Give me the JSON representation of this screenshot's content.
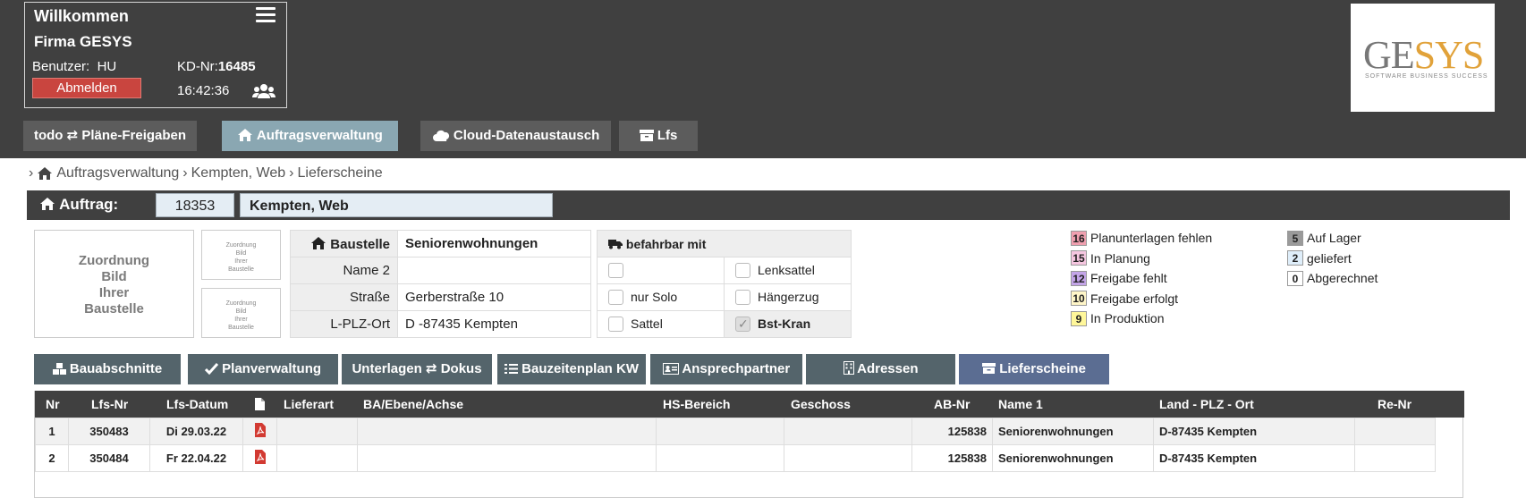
{
  "header": {
    "welcome": "Willkommen",
    "firm": "Firma GESYS",
    "user_label": "Benutzer:",
    "user_value": "HU",
    "kd_label": "KD-Nr:",
    "kd_value": "16485",
    "logout": "Abmelden",
    "time": "16:42:36"
  },
  "logo": {
    "ge": "GE",
    "sys": "SYS",
    "tagline": "SOFTWARE BUSINESS SUCCESS"
  },
  "tabs": [
    {
      "label": "todo ⇄ Pläne-Freigaben"
    },
    {
      "label": "Auftragsverwaltung"
    },
    {
      "label": "Cloud-Datenaustausch"
    },
    {
      "label": "Lfs"
    }
  ],
  "breadcrumb": [
    "Auftragsverwaltung",
    "Kempten, Web",
    "Lieferscheine"
  ],
  "auftrag": {
    "label": "Auftrag:",
    "nr": "18353",
    "name": "Kempten, Web"
  },
  "image_placeholder": {
    "big_lines": [
      "Zuordnung",
      "Bild",
      "Ihrer",
      "Baustelle"
    ],
    "small_lines": [
      "Zuordnung",
      "Bild",
      "Ihrer",
      "Baustelle"
    ]
  },
  "baustelle": {
    "header_key": "Baustelle",
    "header_value": "Seniorenwohnungen",
    "rows": [
      {
        "key": "Name 2",
        "value": ""
      },
      {
        "key": "Straße",
        "value": "Gerberstraße 10"
      },
      {
        "key": "L-PLZ-Ort",
        "value": "D -87435 Kempten"
      }
    ]
  },
  "befahrbar": {
    "title": "befahrbar mit",
    "options": [
      {
        "label": "",
        "checked": false
      },
      {
        "label": "Lenksattel",
        "checked": false
      },
      {
        "label": "nur Solo",
        "checked": false
      },
      {
        "label": "Hängerzug",
        "checked": false
      },
      {
        "label": "Sattel",
        "checked": false
      },
      {
        "label": "Bst-Kran",
        "checked": true
      }
    ]
  },
  "legend_left": [
    {
      "count": "16",
      "label": "Planunterlagen fehlen",
      "color": "#f0a0b0"
    },
    {
      "count": "15",
      "label": "In Planung",
      "color": "#f5c6e0"
    },
    {
      "count": "12",
      "label": "Freigabe fehlt",
      "color": "#c4a5e8"
    },
    {
      "count": "10",
      "label": "Freigabe erfolgt",
      "color": "#fff6c8"
    },
    {
      "count": "9",
      "label": "In Produktion",
      "color": "#fff79a"
    }
  ],
  "legend_right": [
    {
      "count": "5",
      "label": "Auf Lager",
      "color": "#9a9a9a"
    },
    {
      "count": "2",
      "label": "geliefert",
      "color": "#dfeefa"
    },
    {
      "count": "0",
      "label": "Abgerechnet",
      "color": "#ffffff"
    }
  ],
  "buttons": [
    {
      "label": "Bauabschnitte"
    },
    {
      "label": "Planverwaltung"
    },
    {
      "label": "Unterlagen ⇄ Dokus"
    },
    {
      "label": "Bauzeitenplan KW"
    },
    {
      "label": "Ansprechpartner"
    },
    {
      "label": "Adressen"
    },
    {
      "label": "Lieferscheine"
    }
  ],
  "table": {
    "headers": [
      "Nr",
      "Lfs-Nr",
      "Lfs-Datum",
      "",
      "Lieferart",
      "BA/Ebene/Achse",
      "HS-Bereich",
      "Geschoss",
      "AB-Nr",
      "Name 1",
      "Land - PLZ - Ort",
      "Re-Nr"
    ],
    "rows": [
      [
        "1",
        "350483",
        "Di 29.03.22",
        "",
        "",
        "",
        "",
        "",
        "125838",
        "Seniorenwohnungen",
        "D-87435 Kempten",
        ""
      ],
      [
        "2",
        "350484",
        "Fr 22.04.22",
        "",
        "",
        "",
        "",
        "",
        "125838",
        "Seniorenwohnungen",
        "D-87435 Kempten",
        ""
      ]
    ]
  }
}
